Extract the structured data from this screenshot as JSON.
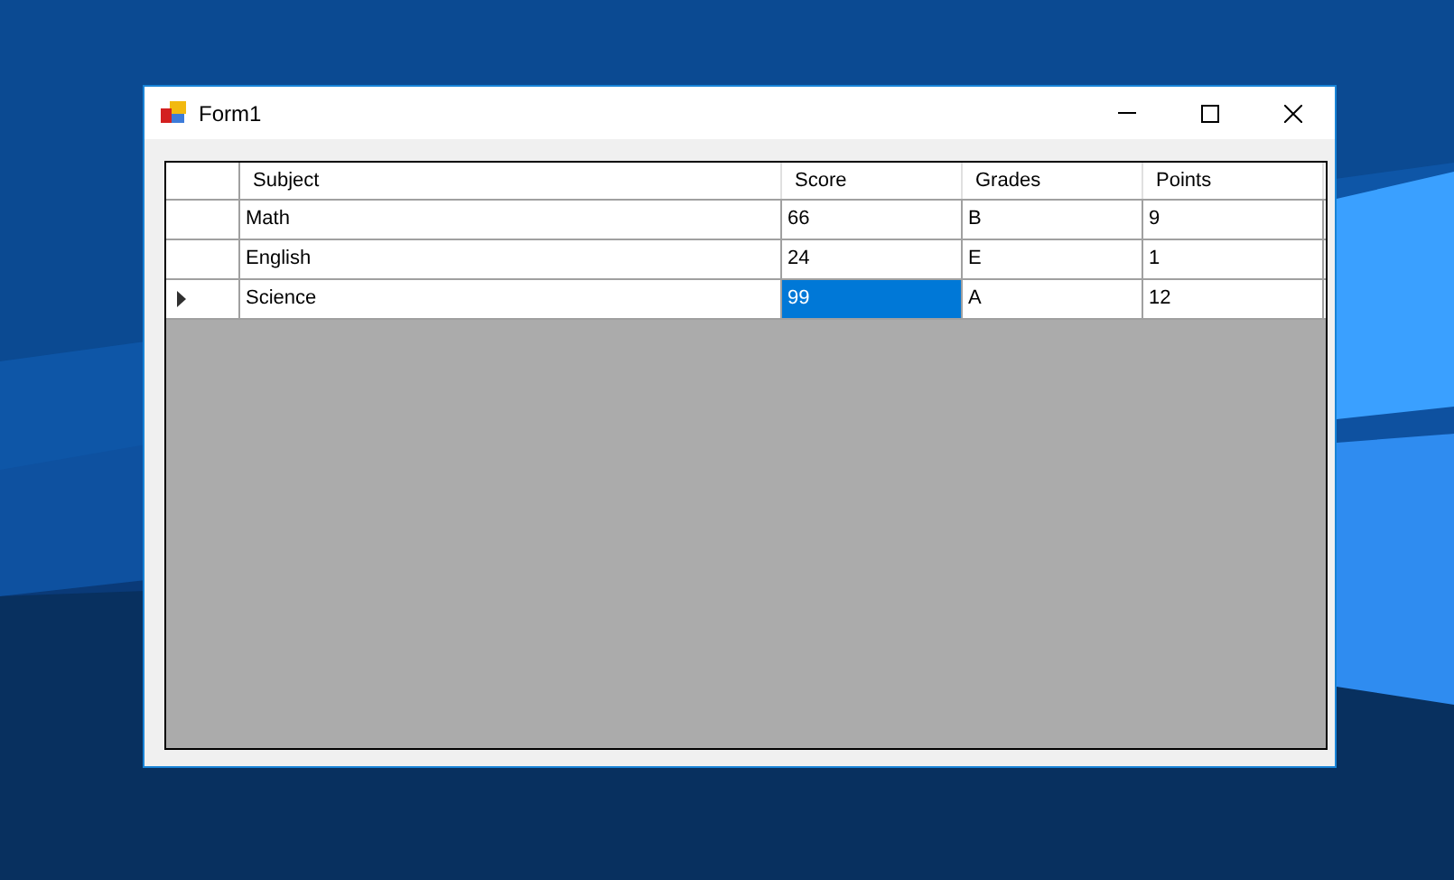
{
  "window": {
    "title": "Form1"
  },
  "table": {
    "columns": [
      "Subject",
      "Score",
      "Grades",
      "Points"
    ],
    "rows": [
      {
        "current": false,
        "cells": [
          {
            "text": "Math",
            "selected": false
          },
          {
            "text": "66",
            "selected": false
          },
          {
            "text": "B",
            "selected": false
          },
          {
            "text": "9",
            "selected": false
          }
        ]
      },
      {
        "current": false,
        "cells": [
          {
            "text": "English",
            "selected": false
          },
          {
            "text": "24",
            "selected": false
          },
          {
            "text": "E",
            "selected": false
          },
          {
            "text": "1",
            "selected": false
          }
        ]
      },
      {
        "current": true,
        "cells": [
          {
            "text": "Science",
            "selected": false
          },
          {
            "text": "99",
            "selected": true
          },
          {
            "text": "A",
            "selected": false
          },
          {
            "text": "12",
            "selected": false
          }
        ]
      }
    ]
  }
}
